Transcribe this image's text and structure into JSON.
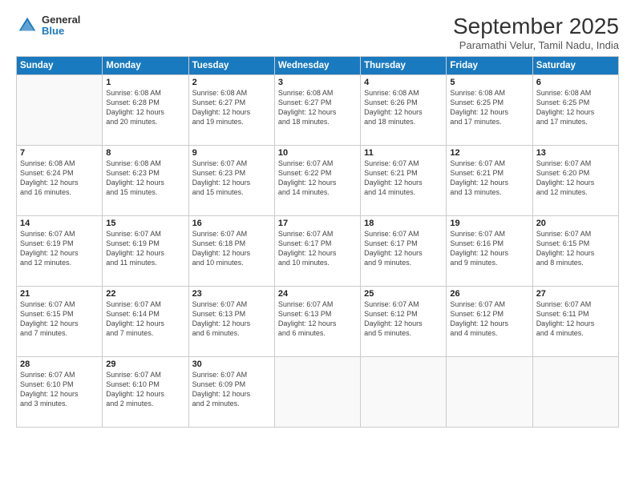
{
  "logo": {
    "general": "General",
    "blue": "Blue"
  },
  "title": "September 2025",
  "subtitle": "Paramathi Velur, Tamil Nadu, India",
  "headers": [
    "Sunday",
    "Monday",
    "Tuesday",
    "Wednesday",
    "Thursday",
    "Friday",
    "Saturday"
  ],
  "weeks": [
    [
      {
        "day": "",
        "info": ""
      },
      {
        "day": "1",
        "info": "Sunrise: 6:08 AM\nSunset: 6:28 PM\nDaylight: 12 hours\nand 20 minutes."
      },
      {
        "day": "2",
        "info": "Sunrise: 6:08 AM\nSunset: 6:27 PM\nDaylight: 12 hours\nand 19 minutes."
      },
      {
        "day": "3",
        "info": "Sunrise: 6:08 AM\nSunset: 6:27 PM\nDaylight: 12 hours\nand 18 minutes."
      },
      {
        "day": "4",
        "info": "Sunrise: 6:08 AM\nSunset: 6:26 PM\nDaylight: 12 hours\nand 18 minutes."
      },
      {
        "day": "5",
        "info": "Sunrise: 6:08 AM\nSunset: 6:25 PM\nDaylight: 12 hours\nand 17 minutes."
      },
      {
        "day": "6",
        "info": "Sunrise: 6:08 AM\nSunset: 6:25 PM\nDaylight: 12 hours\nand 17 minutes."
      }
    ],
    [
      {
        "day": "7",
        "info": "Sunrise: 6:08 AM\nSunset: 6:24 PM\nDaylight: 12 hours\nand 16 minutes."
      },
      {
        "day": "8",
        "info": "Sunrise: 6:08 AM\nSunset: 6:23 PM\nDaylight: 12 hours\nand 15 minutes."
      },
      {
        "day": "9",
        "info": "Sunrise: 6:07 AM\nSunset: 6:23 PM\nDaylight: 12 hours\nand 15 minutes."
      },
      {
        "day": "10",
        "info": "Sunrise: 6:07 AM\nSunset: 6:22 PM\nDaylight: 12 hours\nand 14 minutes."
      },
      {
        "day": "11",
        "info": "Sunrise: 6:07 AM\nSunset: 6:21 PM\nDaylight: 12 hours\nand 14 minutes."
      },
      {
        "day": "12",
        "info": "Sunrise: 6:07 AM\nSunset: 6:21 PM\nDaylight: 12 hours\nand 13 minutes."
      },
      {
        "day": "13",
        "info": "Sunrise: 6:07 AM\nSunset: 6:20 PM\nDaylight: 12 hours\nand 12 minutes."
      }
    ],
    [
      {
        "day": "14",
        "info": "Sunrise: 6:07 AM\nSunset: 6:19 PM\nDaylight: 12 hours\nand 12 minutes."
      },
      {
        "day": "15",
        "info": "Sunrise: 6:07 AM\nSunset: 6:19 PM\nDaylight: 12 hours\nand 11 minutes."
      },
      {
        "day": "16",
        "info": "Sunrise: 6:07 AM\nSunset: 6:18 PM\nDaylight: 12 hours\nand 10 minutes."
      },
      {
        "day": "17",
        "info": "Sunrise: 6:07 AM\nSunset: 6:17 PM\nDaylight: 12 hours\nand 10 minutes."
      },
      {
        "day": "18",
        "info": "Sunrise: 6:07 AM\nSunset: 6:17 PM\nDaylight: 12 hours\nand 9 minutes."
      },
      {
        "day": "19",
        "info": "Sunrise: 6:07 AM\nSunset: 6:16 PM\nDaylight: 12 hours\nand 9 minutes."
      },
      {
        "day": "20",
        "info": "Sunrise: 6:07 AM\nSunset: 6:15 PM\nDaylight: 12 hours\nand 8 minutes."
      }
    ],
    [
      {
        "day": "21",
        "info": "Sunrise: 6:07 AM\nSunset: 6:15 PM\nDaylight: 12 hours\nand 7 minutes."
      },
      {
        "day": "22",
        "info": "Sunrise: 6:07 AM\nSunset: 6:14 PM\nDaylight: 12 hours\nand 7 minutes."
      },
      {
        "day": "23",
        "info": "Sunrise: 6:07 AM\nSunset: 6:13 PM\nDaylight: 12 hours\nand 6 minutes."
      },
      {
        "day": "24",
        "info": "Sunrise: 6:07 AM\nSunset: 6:13 PM\nDaylight: 12 hours\nand 6 minutes."
      },
      {
        "day": "25",
        "info": "Sunrise: 6:07 AM\nSunset: 6:12 PM\nDaylight: 12 hours\nand 5 minutes."
      },
      {
        "day": "26",
        "info": "Sunrise: 6:07 AM\nSunset: 6:12 PM\nDaylight: 12 hours\nand 4 minutes."
      },
      {
        "day": "27",
        "info": "Sunrise: 6:07 AM\nSunset: 6:11 PM\nDaylight: 12 hours\nand 4 minutes."
      }
    ],
    [
      {
        "day": "28",
        "info": "Sunrise: 6:07 AM\nSunset: 6:10 PM\nDaylight: 12 hours\nand 3 minutes."
      },
      {
        "day": "29",
        "info": "Sunrise: 6:07 AM\nSunset: 6:10 PM\nDaylight: 12 hours\nand 2 minutes."
      },
      {
        "day": "30",
        "info": "Sunrise: 6:07 AM\nSunset: 6:09 PM\nDaylight: 12 hours\nand 2 minutes."
      },
      {
        "day": "",
        "info": ""
      },
      {
        "day": "",
        "info": ""
      },
      {
        "day": "",
        "info": ""
      },
      {
        "day": "",
        "info": ""
      }
    ]
  ]
}
